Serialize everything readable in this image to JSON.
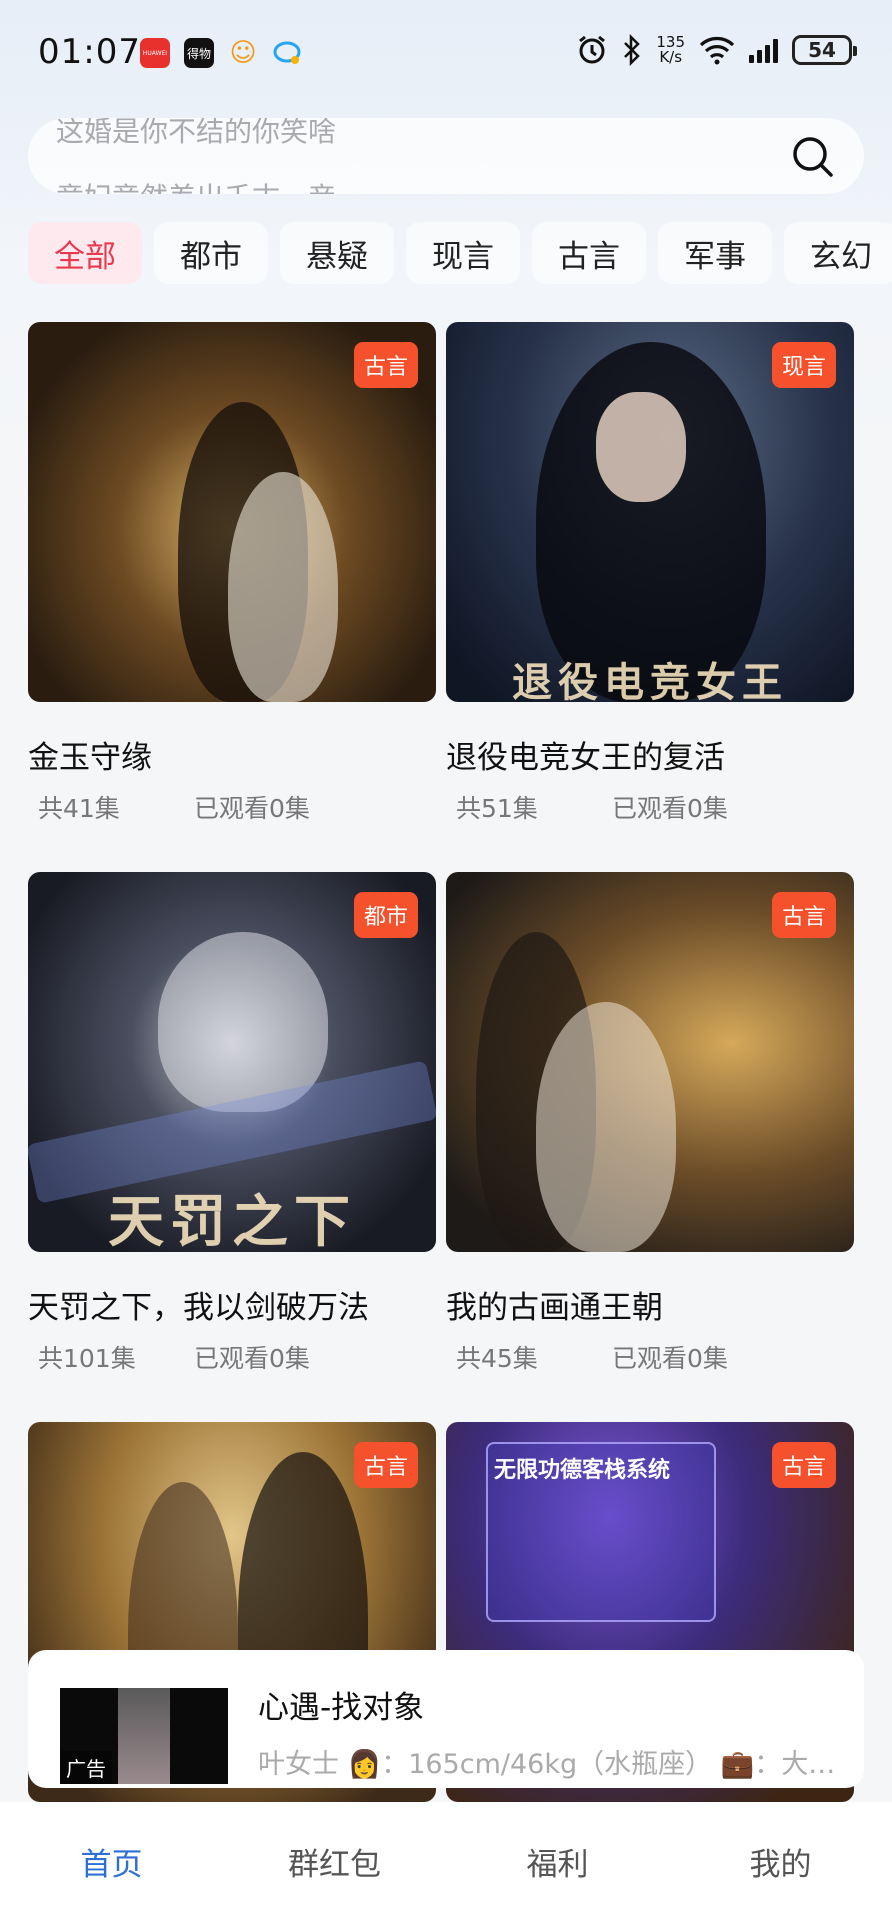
{
  "status_bar": {
    "time": "01:07",
    "speed_value": "135",
    "speed_unit": "K/s",
    "battery": "54",
    "app_icon_labels": [
      "HUAWEI",
      "得物"
    ]
  },
  "search": {
    "lines": [
      "这婚是你不结的你笑啥",
      "竟妃竟然差出千古一帝"
    ]
  },
  "tabs": [
    "全部",
    "都市",
    "悬疑",
    "现言",
    "古言",
    "军事",
    "玄幻"
  ],
  "cards": [
    {
      "title": "金玉守缘",
      "episodes": "共41集",
      "watched": "已观看0集",
      "badge": "古言",
      "cover_text": ""
    },
    {
      "title": "退役电竞女王的复活",
      "episodes": "共51集",
      "watched": "已观看0集",
      "badge": "现言",
      "cover_text": "退役电竞女王"
    },
    {
      "title": "天罚之下，我以剑破万法",
      "episodes": "共101集",
      "watched": "已观看0集",
      "badge": "都市",
      "cover_text": "天罚之下"
    },
    {
      "title": "我的古画通王朝",
      "episodes": "共45集",
      "watched": "已观看0集",
      "badge": "古言",
      "cover_text": ""
    },
    {
      "title": "",
      "episodes": "",
      "watched": "",
      "badge": "古言",
      "cover_text": ""
    },
    {
      "title": "",
      "episodes": "",
      "watched": "",
      "badge": "古言",
      "cover_text": "无限功德客栈系统"
    }
  ],
  "ad": {
    "title": "心遇-找对象",
    "description": "叶女士 👩：165cm/46kg（水瓶座） 💼：大…",
    "label": "广告"
  },
  "bottom_nav": [
    "首页",
    "群红包",
    "福利",
    "我的"
  ],
  "colors": {
    "accent_red": "#e9394f",
    "badge_orange": "#f4512c",
    "nav_active_blue": "#2f6fd1"
  }
}
